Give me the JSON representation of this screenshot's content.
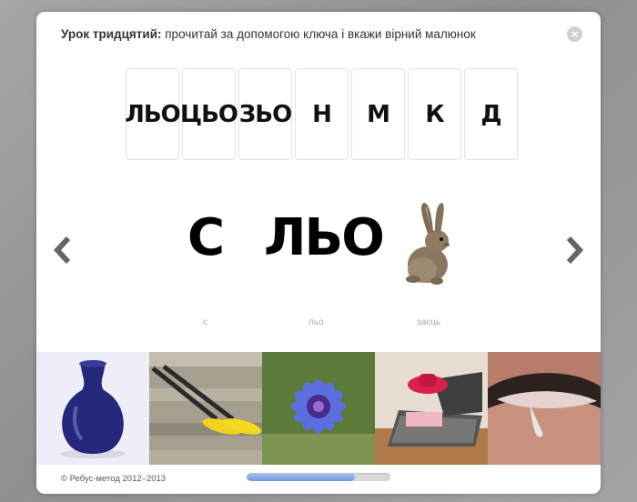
{
  "dialog": {
    "title_bold": "Урок тридцятий:",
    "title_text": " прочитай за допомогою ключа і вкажи вірний малюнок",
    "close_label": "×"
  },
  "keys": [
    "ЛЬО",
    "ЦЬО",
    "ЗЬО",
    "Н",
    "М",
    "К",
    "Д"
  ],
  "rebus": {
    "letter": "С",
    "syllable": "ЛЬО",
    "captions": [
      "с",
      "льо",
      "заєць"
    ],
    "picture": "rabbit-image"
  },
  "nav": {
    "prev": "chevron-left-icon",
    "next": "chevron-right-icon"
  },
  "answers": [
    "vase-image",
    "oars-image",
    "cornflower-image",
    "suitcase-image",
    "tear-image"
  ],
  "footer": {
    "copyright": "© Ребус-метод 2012–2013"
  },
  "progress": {
    "fraction": 0.75
  },
  "colors": {
    "progress_fill": "#6f98d8",
    "background": "#9c9c9c"
  }
}
